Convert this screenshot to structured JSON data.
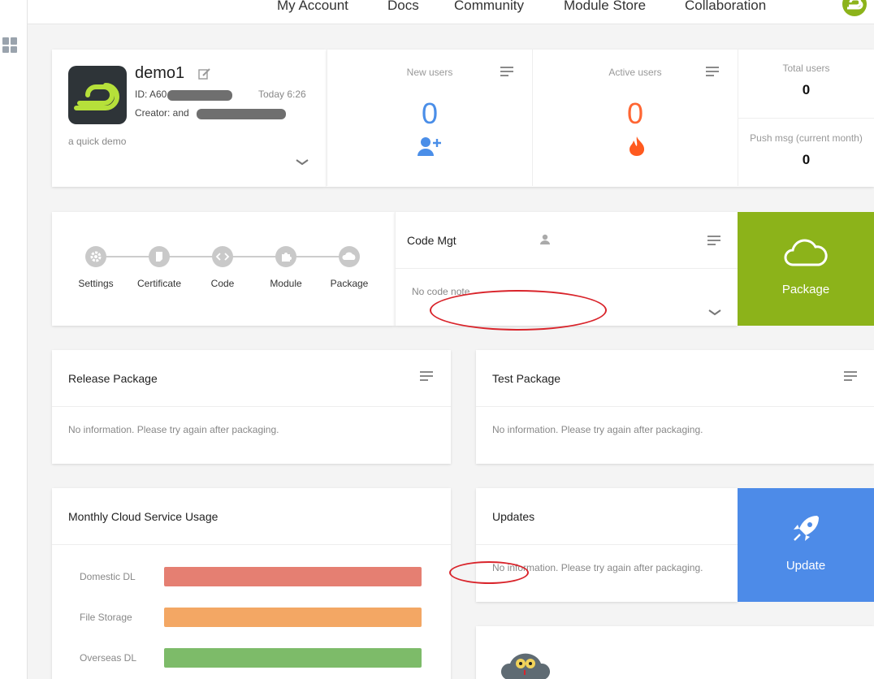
{
  "nav": {
    "links": [
      "My Account",
      "Docs",
      "Community",
      "Module Store",
      "Collaboration"
    ]
  },
  "app": {
    "name": "demo1",
    "id_label": "ID: A60",
    "time": "Today 6:26",
    "creator_label": "Creator: and",
    "description": "a quick demo"
  },
  "stats": {
    "new_users": {
      "label": "New users",
      "value": "0",
      "color": "#4a8ee8"
    },
    "active_users": {
      "label": "Active users",
      "value": "0",
      "color": "#ff6633"
    },
    "total_users": {
      "label": "Total users",
      "value": "0"
    },
    "push_msg": {
      "label": "Push msg (current month)",
      "value": "0"
    }
  },
  "steps": [
    "Settings",
    "Certificate",
    "Code",
    "Module",
    "Package"
  ],
  "code_mgt": {
    "title": "Code Mgt",
    "note": "No code note"
  },
  "package_tile": {
    "label": "Package",
    "color": "#8cb31a"
  },
  "release_package": {
    "title": "Release Package",
    "message": "No information. Please try again after packaging."
  },
  "test_package": {
    "title": "Test Package",
    "message": "No information. Please try again after packaging."
  },
  "cloud_usage": {
    "title": "Monthly Cloud Service Usage",
    "items": [
      {
        "label": "Domestic DL",
        "color": "#e57f72"
      },
      {
        "label": "File Storage",
        "color": "#f3a764"
      },
      {
        "label": "Overseas DL",
        "color": "#7dbb69"
      }
    ]
  },
  "updates": {
    "title": "Updates",
    "message": "No information. Please try again after packaging."
  },
  "update_tile": {
    "label": "Update",
    "color": "#4d8be8"
  }
}
